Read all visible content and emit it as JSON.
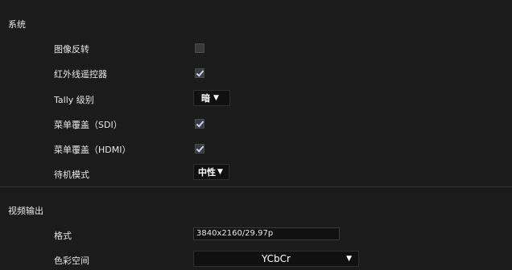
{
  "system": {
    "title": "系统",
    "image_flip": {
      "label": "图像反转",
      "checked": false
    },
    "ir_remote": {
      "label": "红外线遥控器",
      "checked": true
    },
    "tally": {
      "label": "Tally 级别",
      "value": "暗"
    },
    "menu_overlay_sdi": {
      "label": "菜单覆盖（SDI）",
      "checked": true
    },
    "menu_overlay_hdmi": {
      "label": "菜单覆盖（HDMI）",
      "checked": true
    },
    "standby": {
      "label": "待机模式",
      "value": "中性"
    }
  },
  "video_output": {
    "title": "视频输出",
    "format": {
      "label": "格式",
      "value": "3840x2160/29.97p"
    },
    "color_space": {
      "label": "色彩空间",
      "value": "YCbCr"
    }
  }
}
